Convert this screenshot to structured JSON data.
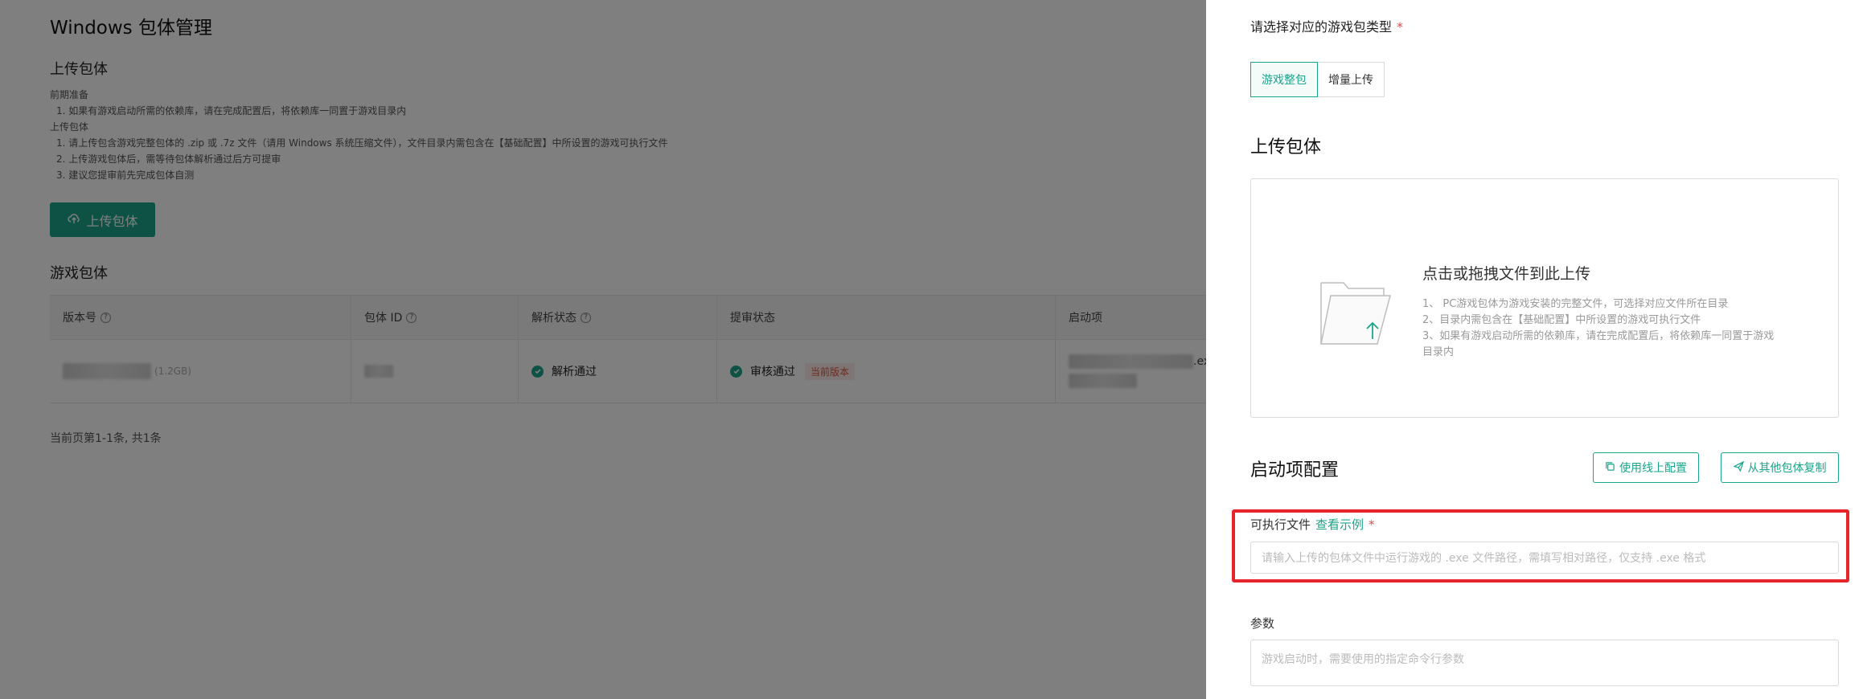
{
  "page": {
    "title": "Windows 包体管理",
    "upload_section_title": "上传包体",
    "notes": [
      {
        "text": "前期准备",
        "indent": false
      },
      {
        "text": "1. 如果有游戏启动所需的依赖库，请在完成配置后，将依赖库一同置于游戏目录内",
        "indent": true
      },
      {
        "text": "上传包体",
        "indent": false
      },
      {
        "text": "1. 请上传包含游戏完整包体的 .zip 或 .7z 文件（请用 Windows 系统压缩文件），文件目录内需包含在【基础配置】中所设置的游戏可执行文件",
        "indent": true
      },
      {
        "text": "2. 上传游戏包体后，需等待包体解析通过后方可提审",
        "indent": true
      },
      {
        "text": "3. 建议您提审前先完成包体自测",
        "indent": true
      }
    ],
    "upload_button": "上传包体",
    "packages_title": "游戏包体",
    "table": {
      "headers": {
        "version": "版本号",
        "package_id": "包体 ID",
        "parse_status": "解析状态",
        "review_status": "提审状态",
        "launch": "启动项"
      },
      "row": {
        "size": "(1.2GB)",
        "parse_status": "解析通过",
        "review_status": "审核通过",
        "current_tag": "当前版本",
        "launch_suffix": ".exe"
      }
    },
    "pagination": "当前页第1-1条, 共1条"
  },
  "drawer": {
    "pkg_type_label": "请选择对应的游戏包类型",
    "pkg_type_required": "*",
    "pkg_type_options": [
      "游戏整包",
      "增量上传"
    ],
    "upload_title": "上传包体",
    "dropzone": {
      "title": "点击或拖拽文件到此上传",
      "notes": [
        "1、 PC游戏包体为游戏安装的完整文件，可选择对应文件所在目录",
        "2、目录内需包含在【基础配置】中所设置的游戏可执行文件",
        "3、如果有游戏启动所需的依赖库，请在完成配置后，将依赖库一同置于游戏目录内"
      ]
    },
    "launch_title": "启动项配置",
    "use_online_config": "使用线上配置",
    "copy_from_other": "从其他包体复制",
    "exe_label": "可执行文件",
    "exe_example_link": "查看示例",
    "exe_required": "*",
    "exe_placeholder": "请输入上传的包体文件中运行游戏的 .exe 文件路径，需填写相对路径，仅支持 .exe 格式",
    "params_label": "参数",
    "params_placeholder": "游戏启动时，需要使用的指定命令行参数"
  },
  "colors": {
    "accent": "#1aa58b",
    "highlight": "#e8242b",
    "required": "#e34d4d",
    "tag_text": "#e0533f"
  }
}
